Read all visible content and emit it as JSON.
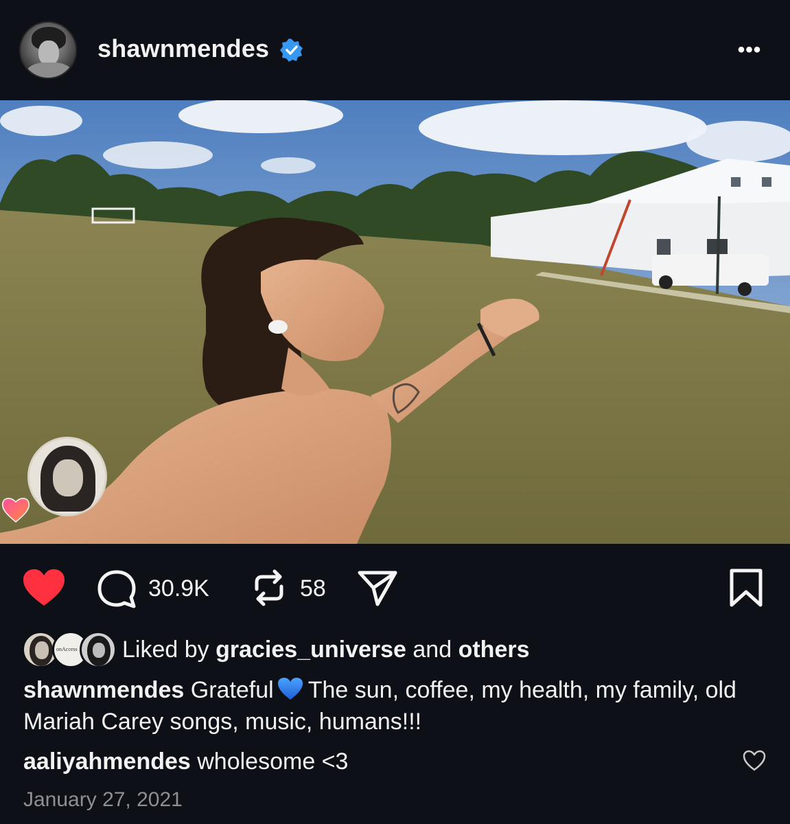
{
  "header": {
    "username": "shawnmendes",
    "verified_icon": "verified-badge-icon",
    "more_label": "•••"
  },
  "post": {
    "story_heart_icon": "heart-gradient-icon"
  },
  "actions": {
    "like_icon": "heart-filled-icon",
    "like_color": "#ff3040",
    "comment_icon": "comment-bubble-icon",
    "comment_count": "30.9K",
    "repost_icon": "repost-icon",
    "repost_count": "58",
    "share_icon": "send-icon",
    "save_icon": "bookmark-icon"
  },
  "liked_by": {
    "prefix": "Liked by",
    "user": "gracies_universe",
    "connector": "and",
    "others": "others",
    "avatar2_text": "onAccess"
  },
  "caption": {
    "username": "shawnmendes",
    "text_before": "Grateful",
    "emoji": "blue-heart",
    "text_after": "The sun, coffee, my health, my family, old Mariah Carey songs, music, humans!!!"
  },
  "comment": {
    "username": "aaliyahmendes",
    "text": "wholesome <3"
  },
  "date": "January 27, 2021"
}
